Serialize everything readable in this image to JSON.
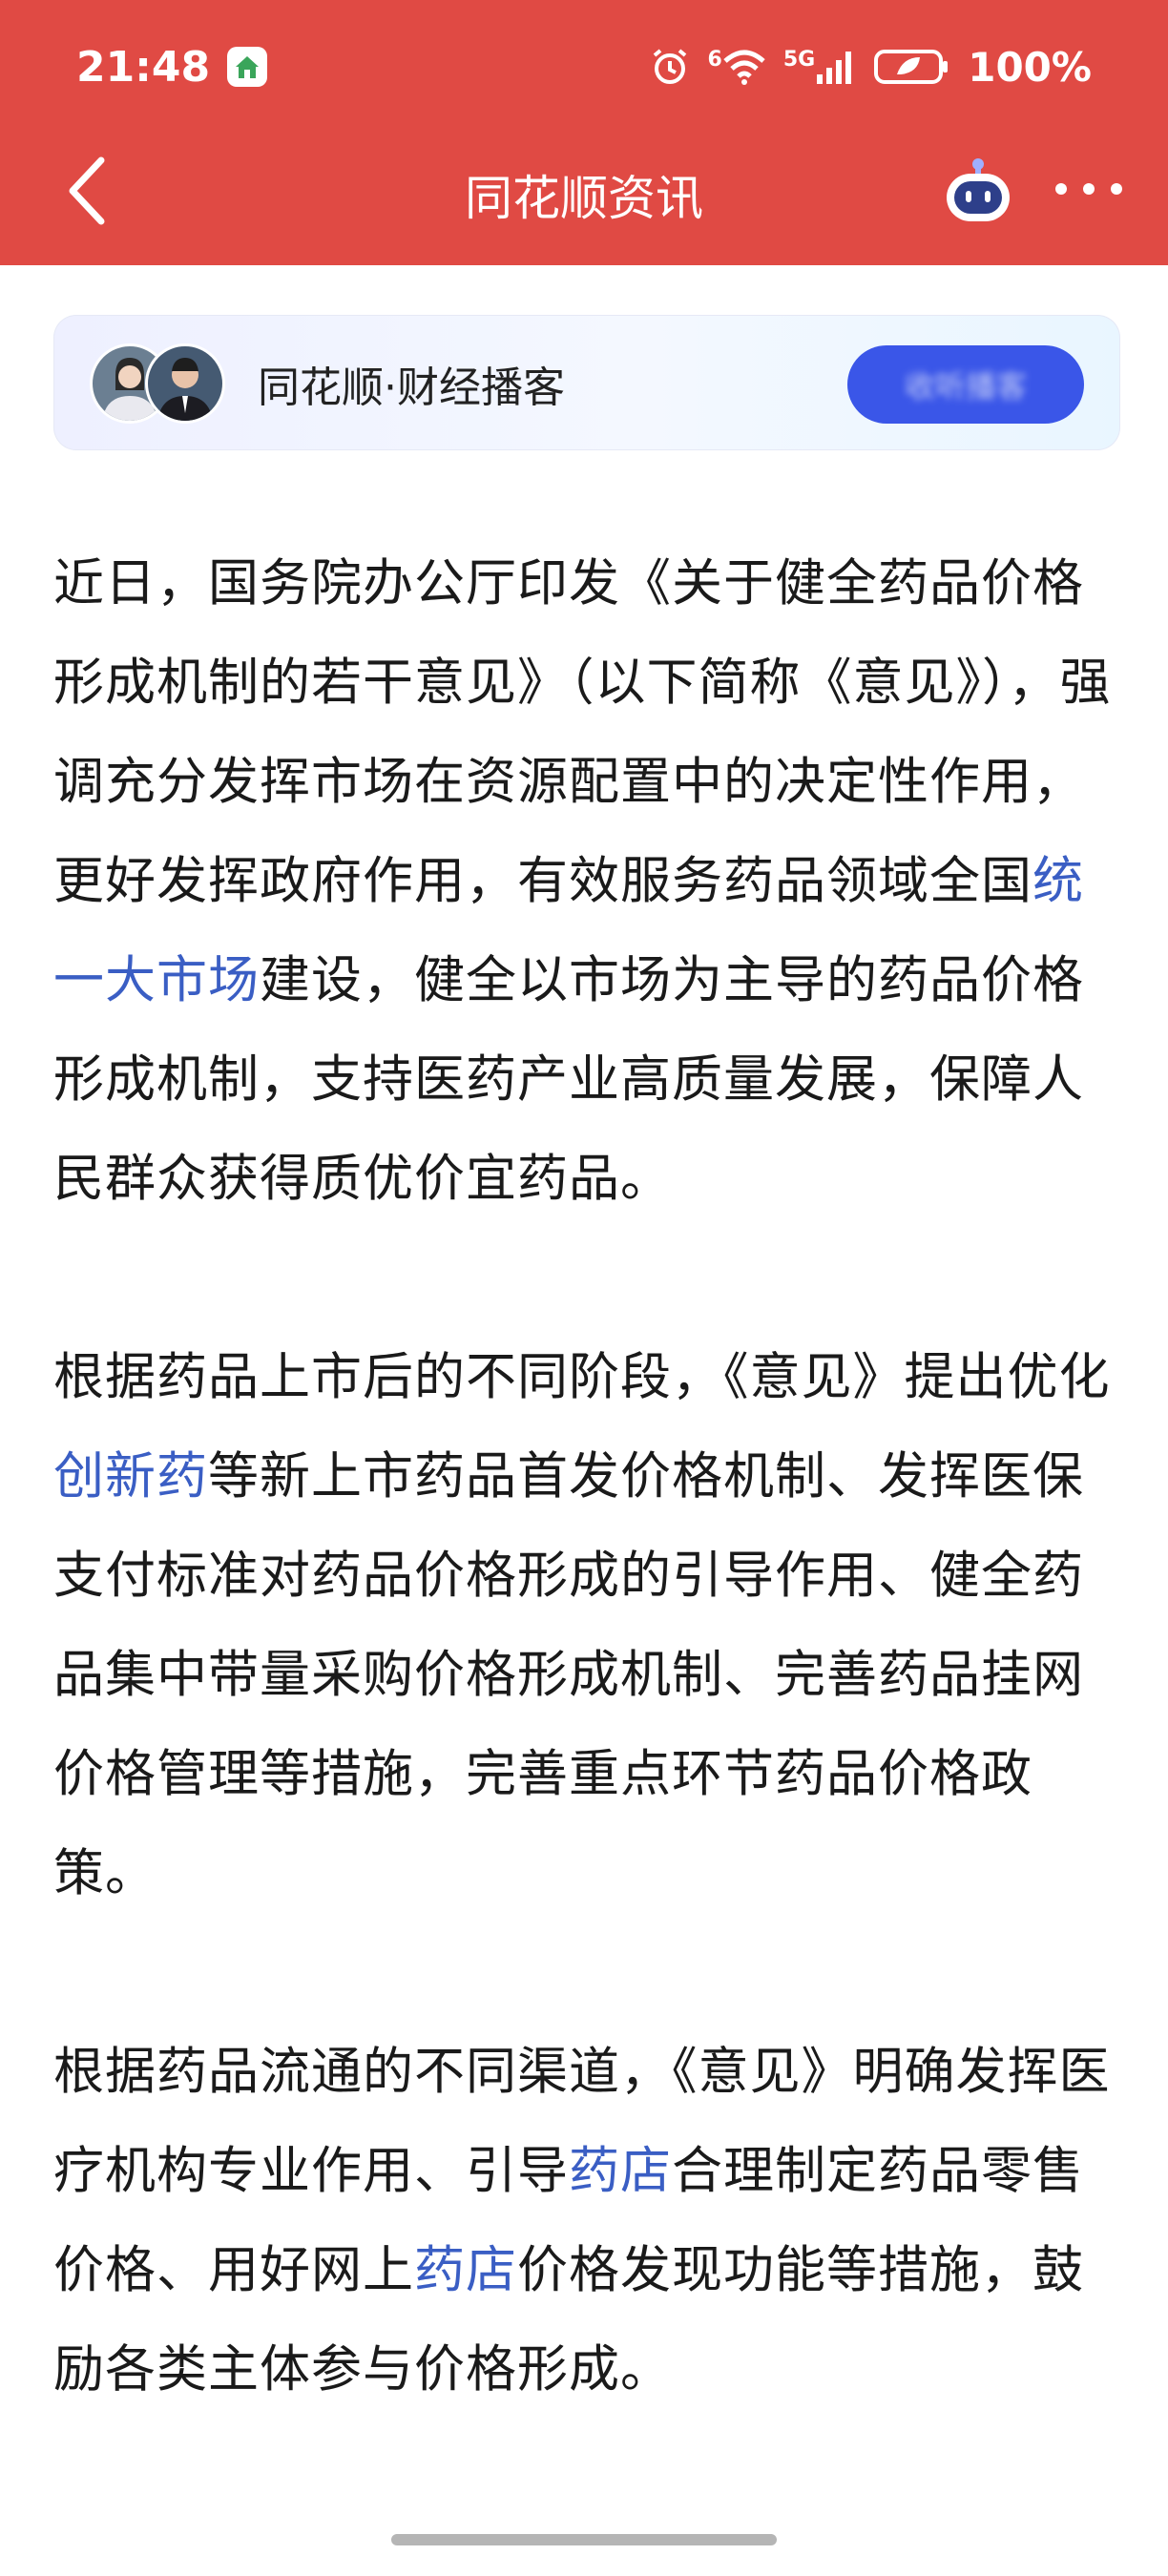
{
  "status_bar": {
    "time": "21:48",
    "signal_superscript": "6",
    "network": "5G",
    "battery": "100%"
  },
  "header": {
    "title": "同花顺资讯"
  },
  "podcast": {
    "label": "同花顺·财经播客",
    "button_label": "收听播客"
  },
  "article": {
    "p1": {
      "t1": "近日，国务院办公厅印发《关于健全药品价格形成机制的若干意见》（以下简称《意见》），强调充分发挥市场在资源配置中的决定性作用，更好发挥政府作用，有效服务药品领域全国",
      "link1": "统一大市场",
      "t2": "建设，健全以市场为主导的药品价格形成机制，支持医药产业高质量发展，保障人民群众获得质优价宜药品。"
    },
    "p2": {
      "t1": "根据药品上市后的不同阶段，《意见》提出优化",
      "link1": "创新药",
      "t2": "等新上市药品首发价格机制、发挥医保支付标准对药品价格形成的引导作用、健全药品集中带量采购价格形成机制、完善药品挂网价格管理等措施，完善重点环节药品价格政策。"
    },
    "p3": {
      "t1": "根据药品流通的不同渠道，《意见》明确发挥医疗机构专业作用、引导",
      "link1": "药店",
      "t2": "合理制定药品零售价格、用好网上",
      "link2": "药店",
      "t3": "价格发现功能等措施，鼓励各类主体参与价格形成。"
    }
  },
  "colors": {
    "header_bg": "#e04a44",
    "link": "#3a5ec4",
    "podcast_button": "#3a56e8"
  },
  "icons": [
    "back-arrow-icon",
    "robot-assistant-icon",
    "more-dots-icon",
    "alarm-icon",
    "wifi-icon",
    "signal-icon",
    "battery-icon",
    "app-home-icon"
  ]
}
